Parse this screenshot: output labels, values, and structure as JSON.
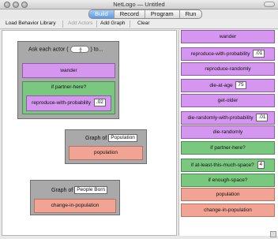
{
  "window": {
    "title": "NetLogo — Untitled"
  },
  "tabs": [
    {
      "label": "Build",
      "active": true
    },
    {
      "label": "Record",
      "active": false
    },
    {
      "label": "Program",
      "active": false
    },
    {
      "label": "Run",
      "active": false
    }
  ],
  "toolbar": {
    "load_library": "Load Behavior Library",
    "add_actors": "Add Actors",
    "add_graph": "Add Graph",
    "clear": "Clear"
  },
  "canvas": {
    "ask_block": {
      "prefix": "Ask each actor (",
      "suffix": ") to...",
      "actor_icon": "stick-figure-icon",
      "wander": "wander",
      "if_label": "if partner-here?",
      "reproduce_label": "reproduce-with-probability",
      "reproduce_value": ".02"
    },
    "graph_population": {
      "label": "Graph of",
      "name": "Population",
      "inner": "population"
    },
    "graph_people_born": {
      "label": "Graph of",
      "name": "People Born",
      "inner": "change-in-population"
    }
  },
  "library": [
    {
      "label": "wander",
      "value": "",
      "color": "purple"
    },
    {
      "label": "reproduce-with-probability",
      "value": ".01",
      "color": "purple"
    },
    {
      "label": "reproduce-randomly",
      "value": "",
      "color": "purple"
    },
    {
      "label": "die-at-age",
      "value": "75",
      "color": "purple"
    },
    {
      "label": "get-older",
      "value": "",
      "color": "purple"
    },
    {
      "label": "die-randomly-with-probability",
      "value": ".01",
      "color": "purple"
    },
    {
      "label": "die-randomly",
      "value": "",
      "color": "purple"
    },
    {
      "label": "if partner-here?",
      "value": "",
      "color": "green"
    },
    {
      "label": "if at-least-this-much-space?",
      "value": "4",
      "color": "green"
    },
    {
      "label": "if enough-space?",
      "value": "",
      "color": "green"
    },
    {
      "label": "population",
      "value": "",
      "color": "salmon"
    },
    {
      "label": "change-in-population",
      "value": "",
      "color": "salmon"
    }
  ],
  "colors": {
    "behavior": "#d596ef",
    "condition": "#7ac77f",
    "reporter": "#f2a494",
    "container": "#a9a9a9",
    "active_tab": "#5c9ae6"
  }
}
